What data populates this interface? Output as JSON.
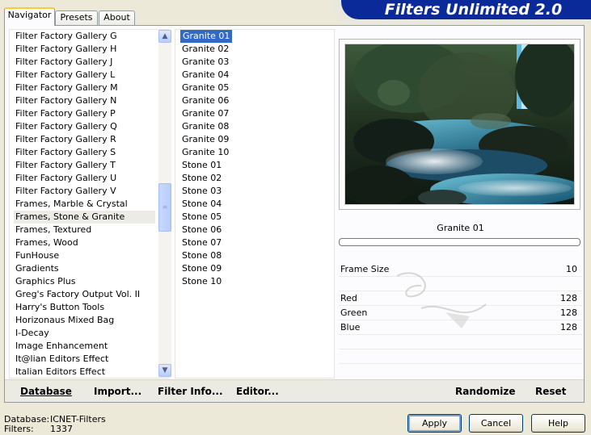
{
  "tabs": [
    "Navigator",
    "Presets",
    "About"
  ],
  "banner_title": "Filters Unlimited 2.0",
  "categories": [
    "Filter Factory Gallery G",
    "Filter Factory Gallery H",
    "Filter Factory Gallery J",
    "Filter Factory Gallery L",
    "Filter Factory Gallery M",
    "Filter Factory Gallery N",
    "Filter Factory Gallery P",
    "Filter Factory Gallery Q",
    "Filter Factory Gallery R",
    "Filter Factory Gallery S",
    "Filter Factory Gallery T",
    "Filter Factory Gallery U",
    "Filter Factory Gallery V",
    "Frames, Marble & Crystal",
    "Frames, Stone & Granite",
    "Frames, Textured",
    "Frames, Wood",
    "FunHouse",
    "Gradients",
    "Graphics Plus",
    "Greg's Factory Output Vol. II",
    "Harry's Button Tools",
    "Horizonaus Mixed Bag",
    "I-Decay",
    "Image Enhancement",
    "It@lian Editors Effect",
    "Italian Editors Effect"
  ],
  "selected_category": "Frames, Stone & Granite",
  "filters": [
    "Granite 01",
    "Granite 02",
    "Granite 03",
    "Granite 04",
    "Granite 05",
    "Granite 06",
    "Granite 07",
    "Granite 08",
    "Granite 09",
    "Granite 10",
    "Stone 01",
    "Stone 02",
    "Stone 03",
    "Stone 04",
    "Stone 05",
    "Stone 06",
    "Stone 07",
    "Stone 08",
    "Stone 09",
    "Stone 10"
  ],
  "selected_filter": "Granite 01",
  "preview_title": "Granite 01",
  "params": [
    {
      "label": "Frame Size",
      "value": "10"
    },
    {
      "label": "Red",
      "value": "128"
    },
    {
      "label": "Green",
      "value": "128"
    },
    {
      "label": "Blue",
      "value": "128"
    }
  ],
  "bottom_bar": {
    "database": "Database",
    "import": "Import...",
    "filter_info": "Filter Info...",
    "editor": "Editor...",
    "randomize": "Randomize",
    "reset": "Reset"
  },
  "status": {
    "database_label": "Database:",
    "database_value": "ICNET-Filters",
    "filters_label": "Filters:",
    "filters_value": "1337"
  },
  "buttons": {
    "apply": "Apply",
    "cancel": "Cancel",
    "help": "Help"
  },
  "watermark": "Pinuccia www.misdisegrafics.eu",
  "colors": {
    "accent": "#0a2a9a",
    "selection": "#316ac5"
  }
}
